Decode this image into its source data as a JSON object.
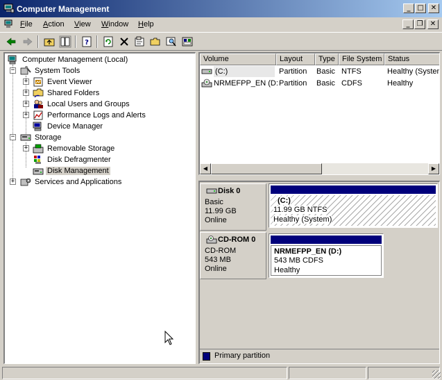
{
  "window": {
    "title": "Computer Management",
    "controls": {
      "minimize": "_",
      "maximize": "□",
      "close": "✕"
    }
  },
  "menu": {
    "items": [
      {
        "label": "File",
        "underline": "F",
        "rest": "ile"
      },
      {
        "label": "Action",
        "underline": "A",
        "rest": "ction"
      },
      {
        "label": "View",
        "underline": "V",
        "rest": "iew"
      },
      {
        "label": "Window",
        "underline": "W",
        "rest": "indow"
      },
      {
        "label": "Help",
        "underline": "H",
        "rest": "elp"
      }
    ],
    "mdi_controls": {
      "minimize": "_",
      "restore": "❐",
      "close": "✕"
    }
  },
  "toolbar": {
    "icons": [
      "back-arrow-icon",
      "forward-arrow-icon",
      "up-folder-icon",
      "show-hide-tree-icon",
      "help-icon",
      "refresh-icon",
      "delete-icon",
      "properties-icon",
      "open-folder-icon",
      "find-icon",
      "settings-icon"
    ]
  },
  "tree": {
    "root": "Computer Management (Local)",
    "system_tools": "System Tools",
    "event_viewer": "Event Viewer",
    "shared_folders": "Shared Folders",
    "local_users": "Local Users and Groups",
    "perf_logs": "Performance Logs and Alerts",
    "device_manager": "Device Manager",
    "storage": "Storage",
    "removable_storage": "Removable Storage",
    "disk_defrag": "Disk Defragmenter",
    "disk_management": "Disk Management",
    "services_apps": "Services and Applications",
    "expand_plus": "+",
    "collapse_minus": "−"
  },
  "volume_list": {
    "columns": [
      "Volume",
      "Layout",
      "Type",
      "File System",
      "Status"
    ],
    "rows": [
      {
        "volume": "(C:)",
        "layout": "Partition",
        "type": "Basic",
        "fs": "NTFS",
        "status": "Healthy (System)"
      },
      {
        "volume": "NRMEFPP_EN (D:)",
        "layout": "Partition",
        "type": "Basic",
        "fs": "CDFS",
        "status": "Healthy"
      }
    ],
    "scroll_left": "◀",
    "scroll_right": "▶"
  },
  "disks": [
    {
      "name": "Disk 0",
      "kind": "Basic",
      "size": "11.99 GB",
      "state": "Online",
      "partition": {
        "name": "(C:)",
        "detail": "11.99 GB NTFS",
        "status": "Healthy (System)"
      }
    },
    {
      "name": "CD-ROM 0",
      "kind": "CD-ROM",
      "size": "543 MB",
      "state": "Online",
      "partition": {
        "name": "NRMEFPP_EN  (D:)",
        "detail": "543 MB CDFS",
        "status": "Healthy"
      }
    }
  ],
  "legend": {
    "label": "Primary partition",
    "color": "#00007b"
  },
  "colors": {
    "titlebar_start": "#0a246a",
    "titlebar_end": "#a6caf0",
    "chrome": "#d4d0c8",
    "partition_header": "#00007b"
  }
}
